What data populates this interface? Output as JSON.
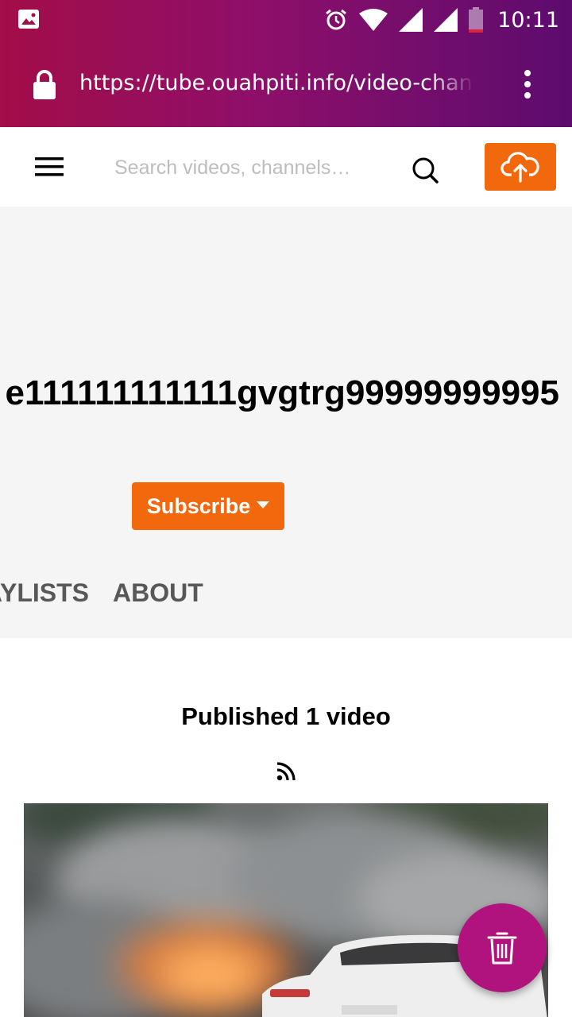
{
  "status_bar": {
    "time": "10:11",
    "left_icon": "image-icon",
    "right_icons": [
      "alarm-icon",
      "wifi-icon",
      "signal-icon",
      "signal-icon",
      "battery-icon"
    ]
  },
  "browser": {
    "url": "https://tube.ouahpiti.info/video-channels/",
    "lock_icon": "lock-icon",
    "menu_icon": "kebab-menu-icon"
  },
  "header": {
    "menu_icon": "hamburger-menu-icon",
    "search_placeholder": "Search videos, channels…",
    "search_value": "",
    "search_icon": "search-icon",
    "upload_icon": "cloud-upload-icon"
  },
  "channel": {
    "name": "e111111111111gvgtrg99999999995",
    "subscribe_label": "Subscribe",
    "tabs": [
      {
        "label": "PLAYLISTS"
      },
      {
        "label": "ABOUT"
      }
    ]
  },
  "content": {
    "published_text": "Published 1 video",
    "rss_icon": "rss-feed-icon"
  },
  "fab": {
    "icon": "trash-icon"
  },
  "colors": {
    "accent_orange": "#f1680d",
    "fab_magenta": "#b0137e",
    "banner_bg": "#f5f5f5"
  }
}
